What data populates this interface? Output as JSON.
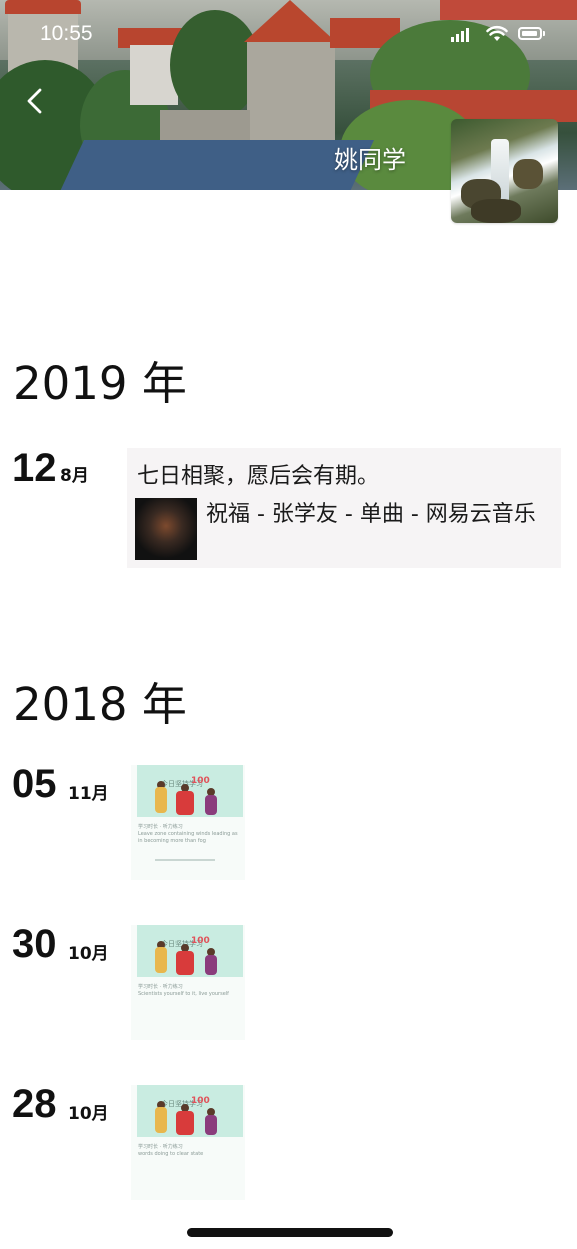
{
  "status_bar": {
    "time": "10:55"
  },
  "header": {
    "name": "姚同学"
  },
  "timeline": [
    {
      "year": "2019 年",
      "entries": [
        {
          "day": "12",
          "month": "8月",
          "text": "七日相聚，愿后会有期。",
          "music": "祝福 - 张学友 - 单曲 - 网易云音乐"
        }
      ]
    },
    {
      "year": "2018 年",
      "entries": [
        {
          "day": "05",
          "month": "11月",
          "card": {
            "banner": "今日坚持学习",
            "count": "100",
            "meta": "学习时长 · 听力练习",
            "desc": "Leave zone containing winds leading as in becoming more than fog"
          }
        },
        {
          "day": "30",
          "month": "10月",
          "card": {
            "banner": "今日坚持学习",
            "count": "100",
            "meta": "学习时长 · 听力练习",
            "desc": "Scientists yourself to it, live yourself"
          }
        },
        {
          "day": "28",
          "month": "10月",
          "card": {
            "banner": "今日坚持学习",
            "count": "100",
            "meta": "学习时长 · 听力练习",
            "desc": "words doing to clear state"
          }
        }
      ]
    }
  ],
  "colors": {
    "post_background": "#f6f4f5",
    "card_banner": "#c9ece1"
  },
  "icons": [
    "back-chevron-icon",
    "signal-icon",
    "wifi-icon",
    "battery-icon"
  ]
}
